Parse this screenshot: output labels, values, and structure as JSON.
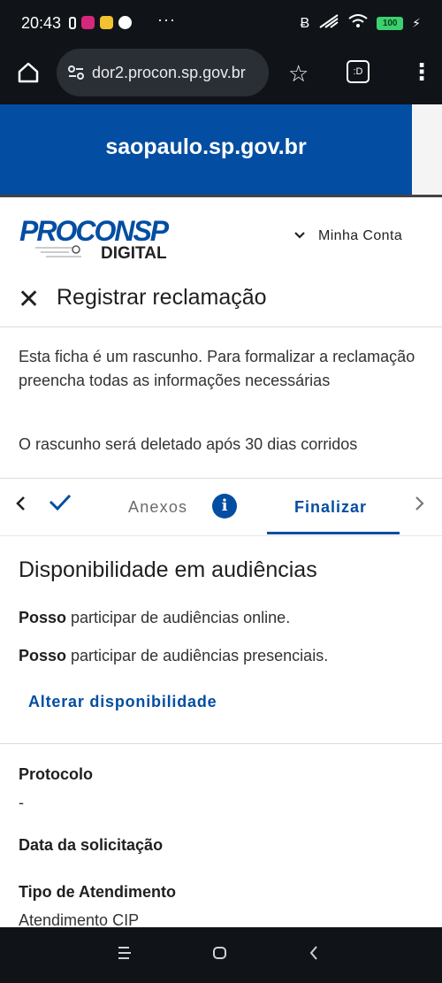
{
  "status_bar": {
    "time": "20:43",
    "more": "···",
    "battery": "100"
  },
  "browser": {
    "url": "dor2.procon.sp.gov.br",
    "tabs_label": ":D"
  },
  "gov_banner": {
    "text": "saopaulo.sp.gov.br"
  },
  "header": {
    "logo_text_top": "PROCONSP",
    "logo_text_bottom": "DIGITAL",
    "account_label": "Minha Conta"
  },
  "page": {
    "title": "Registrar reclamação",
    "draft_notice": "Esta ficha é um rascunho. Para formalizar a reclamação preencha todas as informações necessárias",
    "draft_deletion": "O rascunho será deletado após 30 dias corridos"
  },
  "steps": {
    "anexos": "Anexos",
    "info": "i",
    "finalizar": "Finalizar"
  },
  "availability": {
    "title": "Disponibilidade em audiências",
    "online_bold": "Posso",
    "online_rest": " participar de audiências online.",
    "presencial_bold": "Posso",
    "presencial_rest": " participar de audiências presenciais.",
    "change_link": "Alterar disponibilidade"
  },
  "details": {
    "protocolo_label": "Protocolo",
    "protocolo_value": "-",
    "data_label": "Data da solicitação",
    "tipo_label": "Tipo de Atendimento",
    "tipo_value": "Atendimento CIP"
  },
  "colors": {
    "brand_blue": "#034ea2",
    "dark_bar": "#101418"
  }
}
